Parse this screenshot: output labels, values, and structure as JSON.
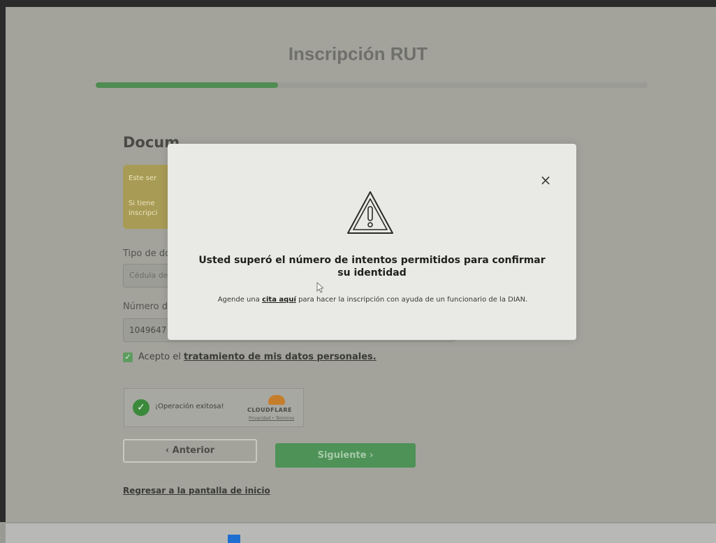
{
  "header": {
    "title": "Inscripción RUT",
    "progress_fraction": 0.33
  },
  "form": {
    "section_heading": "Docum",
    "info_box": {
      "line1": "Este ser",
      "line2": "Si tiene",
      "line3": "inscripci"
    },
    "doc_type": {
      "label": "Tipo de dc",
      "value": "Cédula de"
    },
    "doc_number": {
      "label": "Número d",
      "value": "1049647"
    },
    "consent": {
      "prefix": "Acepto el",
      "link": "tratamiento de mis datos personales."
    },
    "captcha": {
      "status": "¡Operación exitosa!",
      "brand": "CLOUDFLARE",
      "links": "Privacidad • Términos"
    },
    "buttons": {
      "prev": "‹  Anterior",
      "next": "Siguiente  ›"
    },
    "back_link": "Regresar a la pantalla de inicio"
  },
  "modal": {
    "close_glyph": "×",
    "icon": "warning-triangle-icon",
    "title": "Usted superó el número de intentos permitidos para confirmar su identidad",
    "body_prefix": "Agende una",
    "body_link": "cita aquí",
    "body_suffix": "para hacer la inscripción con ayuda de un funcionario de la DIAN."
  },
  "colors": {
    "accent_green": "#4f8c52",
    "warning_box": "#a89b55",
    "modal_bg": "#e9e9e5"
  }
}
